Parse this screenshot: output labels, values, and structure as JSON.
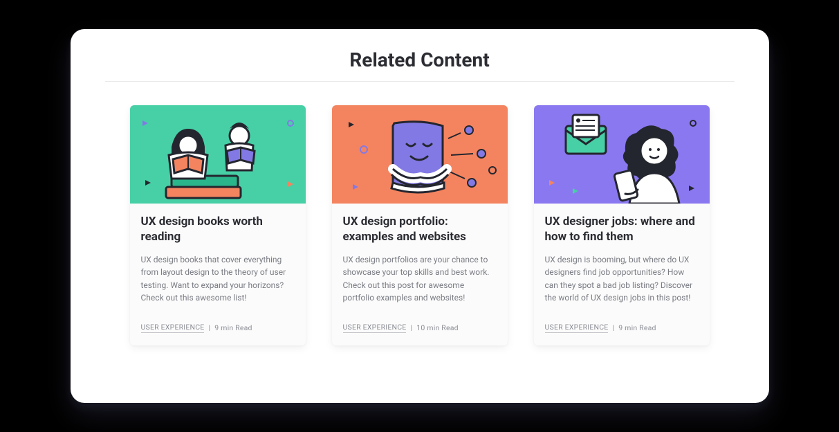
{
  "section": {
    "title": "Related Content"
  },
  "cards": [
    {
      "title": "UX design books worth reading",
      "desc": "UX design books that cover everything from layout design to the theory of user testing. Want to expand your horizons? Check out this awesome list!",
      "category": "USER EXPERIENCE",
      "read_time": "9 min Read"
    },
    {
      "title": "UX design portfolio: examples and websites",
      "desc": "UX design portfolios are your chance to showcase your top skills and best work. Check out this post for awesome portfolio examples and websites!",
      "category": "USER EXPERIENCE",
      "read_time": "10 min Read"
    },
    {
      "title": "UX designer jobs: where and how to find them",
      "desc": "UX design is booming, but where do UX designers find job opportunities? How can they spot a bad job listing? Discover the world of UX design jobs in this post!",
      "category": "USER EXPERIENCE",
      "read_time": "9 min Read"
    }
  ]
}
